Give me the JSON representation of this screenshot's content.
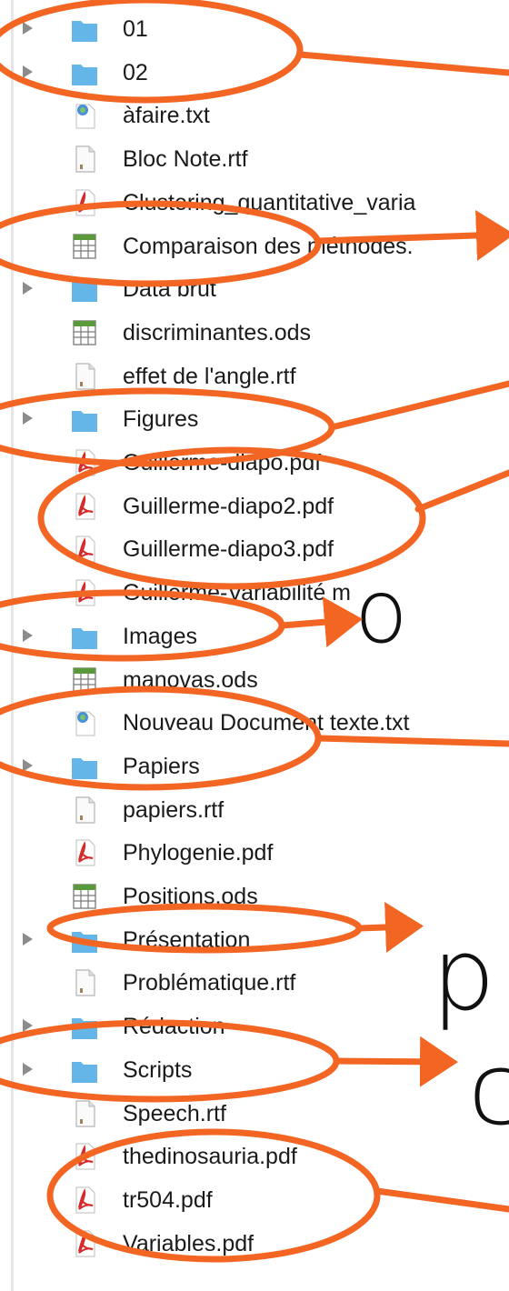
{
  "colors": {
    "annotation": "#f26522",
    "folder": "#64b5e8",
    "pdf": "#d42a2a",
    "spreadsheet": "#5a9a3c"
  },
  "files": [
    {
      "name": "01",
      "kind": "folder",
      "icon": "folder-icon"
    },
    {
      "name": "02",
      "kind": "folder",
      "icon": "folder-icon"
    },
    {
      "name": "àfaire.txt",
      "kind": "txt",
      "icon": "text-document-icon"
    },
    {
      "name": "Bloc Note.rtf",
      "kind": "rtf",
      "icon": "document-icon"
    },
    {
      "name": "Clustering_quantitative_varia",
      "kind": "pdf",
      "icon": "pdf-icon"
    },
    {
      "name": "Comparaison des méthodes.",
      "kind": "ods",
      "icon": "spreadsheet-icon"
    },
    {
      "name": "Data brut",
      "kind": "folder",
      "icon": "folder-icon"
    },
    {
      "name": "discriminantes.ods",
      "kind": "ods",
      "icon": "spreadsheet-icon"
    },
    {
      "name": "effet de l'angle.rtf",
      "kind": "rtf",
      "icon": "document-icon"
    },
    {
      "name": "Figures",
      "kind": "folder",
      "icon": "folder-icon"
    },
    {
      "name": "Guillerme-diapo.pdf",
      "kind": "pdf",
      "icon": "pdf-icon"
    },
    {
      "name": "Guillerme-diapo2.pdf",
      "kind": "pdf",
      "icon": "pdf-icon"
    },
    {
      "name": "Guillerme-diapo3.pdf",
      "kind": "pdf",
      "icon": "pdf-icon"
    },
    {
      "name": "Guillerme-Variabilité m",
      "kind": "pdf",
      "icon": "pdf-icon"
    },
    {
      "name": "Images",
      "kind": "folder",
      "icon": "folder-icon"
    },
    {
      "name": "manovas.ods",
      "kind": "ods",
      "icon": "spreadsheet-icon"
    },
    {
      "name": "Nouveau Document texte.txt",
      "kind": "txt",
      "icon": "text-document-icon"
    },
    {
      "name": "Papiers",
      "kind": "folder",
      "icon": "folder-icon"
    },
    {
      "name": "papiers.rtf",
      "kind": "rtf",
      "icon": "document-icon"
    },
    {
      "name": "Phylogenie.pdf",
      "kind": "pdf",
      "icon": "pdf-icon"
    },
    {
      "name": "Positions.ods",
      "kind": "ods",
      "icon": "spreadsheet-icon"
    },
    {
      "name": "Présentation",
      "kind": "folder",
      "icon": "folder-icon"
    },
    {
      "name": "Problématique.rtf",
      "kind": "rtf",
      "icon": "document-icon"
    },
    {
      "name": "Rédaction",
      "kind": "folder",
      "icon": "folder-icon"
    },
    {
      "name": "Scripts",
      "kind": "folder",
      "icon": "folder-icon"
    },
    {
      "name": "Speech.rtf",
      "kind": "rtf",
      "icon": "document-icon"
    },
    {
      "name": "thedinosauria.pdf",
      "kind": "pdf",
      "icon": "pdf-icon"
    },
    {
      "name": "tr504.pdf",
      "kind": "pdf",
      "icon": "pdf-icon"
    },
    {
      "name": "Variables.pdf",
      "kind": "pdf",
      "icon": "pdf-icon"
    }
  ],
  "overlay_text": {
    "images_cut": "o",
    "presentation_cut": "p",
    "scripts_cut": "c"
  }
}
